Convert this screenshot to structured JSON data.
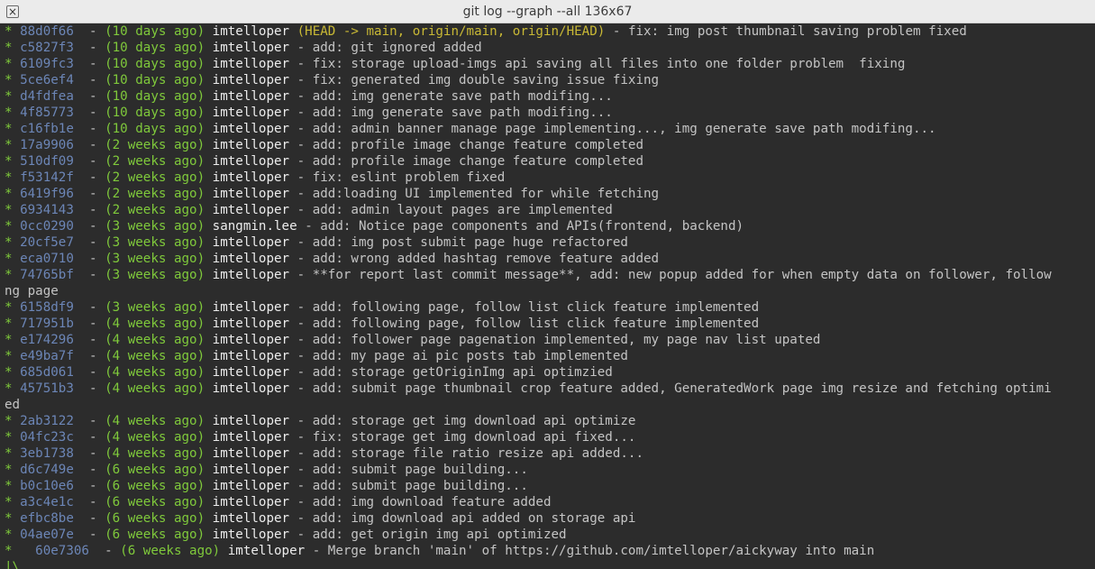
{
  "window": {
    "title": "git log --graph --all 136x67"
  },
  "commits": [
    {
      "hash": "88d0f66",
      "age": "(10 days ago)",
      "author": "imtelloper",
      "refs": "(HEAD -> main, origin/main, origin/HEAD)",
      "msg": "- fix: img post thumbnail saving problem fixed"
    },
    {
      "hash": "c5827f3",
      "age": "(10 days ago)",
      "author": "imtelloper",
      "msg": "- add: git ignored added"
    },
    {
      "hash": "6109fc3",
      "age": "(10 days ago)",
      "author": "imtelloper",
      "msg": "- fix: storage upload-imgs api saving all files into one folder problem  fixing"
    },
    {
      "hash": "5ce6ef4",
      "age": "(10 days ago)",
      "author": "imtelloper",
      "msg": "- fix: generated img double saving issue fixing"
    },
    {
      "hash": "d4fdfea",
      "age": "(10 days ago)",
      "author": "imtelloper",
      "msg": "- add: img generate save path modifing..."
    },
    {
      "hash": "4f85773",
      "age": "(10 days ago)",
      "author": "imtelloper",
      "msg": "- add: img generate save path modifing..."
    },
    {
      "hash": "c16fb1e",
      "age": "(10 days ago)",
      "author": "imtelloper",
      "msg": "- add: admin banner manage page implementing..., img generate save path modifing..."
    },
    {
      "hash": "17a9906",
      "age": "(2 weeks ago)",
      "author": "imtelloper",
      "msg": "- add: profile image change feature completed"
    },
    {
      "hash": "510df09",
      "age": "(2 weeks ago)",
      "author": "imtelloper",
      "msg": "- add: profile image change feature completed"
    },
    {
      "hash": "f53142f",
      "age": "(2 weeks ago)",
      "author": "imtelloper",
      "msg": "- fix: eslint problem fixed"
    },
    {
      "hash": "6419f96",
      "age": "(2 weeks ago)",
      "author": "imtelloper",
      "msg": "- add:loading UI implemented for while fetching"
    },
    {
      "hash": "6934143",
      "age": "(2 weeks ago)",
      "author": "imtelloper",
      "msg": "- add: admin layout pages are implemented"
    },
    {
      "hash": "0cc0290",
      "age": "(3 weeks ago)",
      "author": "sangmin.lee",
      "msg": "- add: Notice page components and APIs(frontend, backend)"
    },
    {
      "hash": "20cf5e7",
      "age": "(3 weeks ago)",
      "author": "imtelloper",
      "msg": "- add: img post submit page huge refactored"
    },
    {
      "hash": "eca0710",
      "age": "(3 weeks ago)",
      "author": "imtelloper",
      "msg": "- add: wrong added hashtag remove feature added"
    },
    {
      "hash": "74765bf",
      "age": "(3 weeks ago)",
      "author": "imtelloper",
      "msg": "- **for report last commit message**, add: new popup added for when empty data on follower, follow",
      "wrap": "ng page"
    },
    {
      "hash": "6158df9",
      "age": "(3 weeks ago)",
      "author": "imtelloper",
      "msg": "- add: following page, follow list click feature implemented"
    },
    {
      "hash": "717951b",
      "age": "(4 weeks ago)",
      "author": "imtelloper",
      "msg": "- add: following page, follow list click feature implemented"
    },
    {
      "hash": "e174296",
      "age": "(4 weeks ago)",
      "author": "imtelloper",
      "msg": "- add: follower page pagenation implemented, my page nav list upated"
    },
    {
      "hash": "e49ba7f",
      "age": "(4 weeks ago)",
      "author": "imtelloper",
      "msg": "- add: my page ai pic posts tab implemented"
    },
    {
      "hash": "685d061",
      "age": "(4 weeks ago)",
      "author": "imtelloper",
      "msg": "- add: storage getOriginImg api optimzied"
    },
    {
      "hash": "45751b3",
      "age": "(4 weeks ago)",
      "author": "imtelloper",
      "msg": "- add: submit page thumbnail crop feature added, GeneratedWork page img resize and fetching optimi",
      "wrap": "ed"
    },
    {
      "hash": "2ab3122",
      "age": "(4 weeks ago)",
      "author": "imtelloper",
      "msg": "- add: storage get img download api optimize"
    },
    {
      "hash": "04fc23c",
      "age": "(4 weeks ago)",
      "author": "imtelloper",
      "msg": "- fix: storage get img download api fixed..."
    },
    {
      "hash": "3eb1738",
      "age": "(4 weeks ago)",
      "author": "imtelloper",
      "msg": "- add: storage file ratio resize api added..."
    },
    {
      "hash": "d6c749e",
      "age": "(6 weeks ago)",
      "author": "imtelloper",
      "msg": "- add: submit page building..."
    },
    {
      "hash": "b0c10e6",
      "age": "(6 weeks ago)",
      "author": "imtelloper",
      "msg": "- add: submit page building..."
    },
    {
      "hash": "a3c4e1c",
      "age": "(6 weeks ago)",
      "author": "imtelloper",
      "msg": "- add: img download feature added"
    },
    {
      "hash": "efbc8be",
      "age": "(6 weeks ago)",
      "author": "imtelloper",
      "msg": "- add: img download api added on storage api"
    },
    {
      "hash": "04ae07e",
      "age": "(6 weeks ago)",
      "author": "imtelloper",
      "msg": "- add: get origin img api optimized"
    },
    {
      "hash": "60e7306",
      "age": "(6 weeks ago)",
      "author": "imtelloper",
      "msg": "- Merge branch 'main' of https://github.com/imtelloper/aickyway into main",
      "merge": true
    }
  ],
  "graph": {
    "star": "*",
    "trailing": "|\\"
  },
  "colors": {
    "background": "#2c2c2c",
    "graph": "#7fc93b",
    "hash": "#6c86b7",
    "age": "#7fc93b",
    "author": "#ececec",
    "refs": "#c9b935",
    "message": "#c4c4c4"
  }
}
